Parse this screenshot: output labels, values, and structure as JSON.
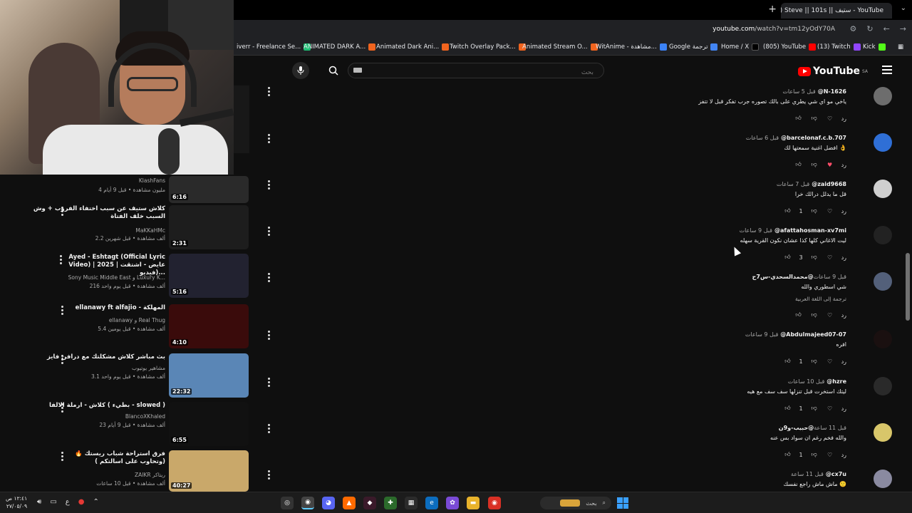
{
  "browser": {
    "tab_title": "(77) Steve || 101s || ستيف - YouTube",
    "url": "youtube.com/watch?v=tm12yOdY70A",
    "url_host": "youtube.com",
    "url_path": "/watch?v=tm12yOdY70A",
    "bookmarks": [
      {
        "label": "iverr - Freelance Se...",
        "icon_color": "#1dbf73"
      },
      {
        "label": "ANIMATED DARK A...",
        "icon_color": "#f1641e"
      },
      {
        "label": "Animated Dark Ani...",
        "icon_color": "#f1641e"
      },
      {
        "label": "Twitch Overlay Pack...",
        "icon_color": "#f1641e"
      },
      {
        "label": "Animated Stream O...",
        "icon_color": "#f1641e"
      },
      {
        "label": "WitAnime - مشاهدة...",
        "icon_color": "#3b82f6"
      },
      {
        "label": "Google ترجمة",
        "icon_color": "#4285f4"
      },
      {
        "label": "Home / X",
        "icon_color": "#000000"
      },
      {
        "label": "(805) YouTube",
        "icon_color": "#ff0000"
      },
      {
        "label": "(13) Twitch",
        "icon_color": "#9146ff"
      },
      {
        "label": "Kick",
        "icon_color": "#53fc18"
      }
    ]
  },
  "header": {
    "logo": "YouTube",
    "region": "SA",
    "search_placeholder": "بحث"
  },
  "suggested": [
    {
      "title": "",
      "channel": "KlashFans",
      "meta": "4 مليون مشاهدة • قبل 9 أيام",
      "duration": "6:16",
      "thumb": "#2a2a2a"
    },
    {
      "title": "كلاش ستيف عن سبب اختفاء الفروب + وش السبب خلف الفتاة",
      "channel": "MaKKaHMc",
      "meta": "2.2 ألف مشاهدة • قبل شهرين",
      "duration": "2:31",
      "thumb": "#1d1d1d"
    },
    {
      "title": "Ayed - Eshtagt (Official Lyric Video) | 2025 | عايض - اشتقت (فيديو...",
      "channel": "Sony Music Middle East و Luxury K...",
      "meta": "216 ألف مشاهدة • قبل يوم واحد",
      "duration": "5:16",
      "thumb": "#222230"
    },
    {
      "title": "ellanawy ft alfajio - المهلكة",
      "channel": "ellanawy و Real Thug",
      "meta": "5.4 ألف مشاهدة • قبل يومين",
      "duration": "4:10",
      "thumb": "#3a0b0b"
    },
    {
      "title": "بث مباشر كلاش مشكلتك مع درافن فايز",
      "channel": "مشاهير يوتيوب",
      "meta": "3.1 ألف مشاهدة • قبل يوم واحد",
      "duration": "22:32",
      "thumb": "#5a86b6"
    },
    {
      "title": "كلاش - ارملة الالفا ( بطيء - slowed )",
      "channel": "BlancoXKhaled",
      "meta": "23 ألف مشاهدة • قبل 9 أيام",
      "duration": "6:55",
      "thumb": "#111111"
    },
    {
      "title": "فرق استراحة شباب ريستك 🔥 (وتحاوب على اسالتكم )",
      "channel": "ZAIKR ريتاكر",
      "meta": "ألف مشاهدة • قبل 10 ساعات",
      "duration": "40:27",
      "thumb": "#c9a86a"
    }
  ],
  "comments": [
    {
      "user": "@N-1626",
      "time": "قبل 5 ساعات",
      "text": "ياخي مو اي شي يطري على بالك تصوره جرب تفكر قبل لا تتفز",
      "likes": "",
      "reply": "رد",
      "avatar": "#6d6d6d"
    },
    {
      "user": "@barcelonaf.c.b.707",
      "time": "قبل 6 ساعات",
      "text": "افضل اغنية سمعتها لك 👌",
      "likes": "",
      "reply": "رد",
      "avatar": "#2f6fd6",
      "hearted": true
    },
    {
      "user": "@zaid9668",
      "time": "قبل 7 ساعات",
      "text": "قل ما يدلل درالك خرا",
      "likes": "1",
      "reply": "رد",
      "avatar": "#cfcfcf"
    },
    {
      "user": "@afattahosman-xv7mi",
      "time": "قبل 9 ساعات",
      "text": "ليت الاغاني كلها كذا عشان نكون القرية سهله",
      "likes": "3",
      "reply": "رد",
      "avatar": "#222222"
    },
    {
      "user": "@محمدالسحدي-س7ح",
      "time": "قبل 9 ساعات",
      "text": "شي اسطوري والله",
      "translate": "ترجمة إلى اللغة العربية",
      "likes": "",
      "reply": "رد",
      "avatar": "#53607a"
    },
    {
      "user": "@Abdulmajeed07-07",
      "time": "قبل 9 ساعات",
      "text": "افره",
      "likes": "1",
      "reply": "رد",
      "avatar": "#1a1010"
    },
    {
      "user": "@hzre",
      "time": "قبل 10 ساعات",
      "text": "ليتك استخرت قبل تنزلها سف سف مع هيه",
      "likes": "1",
      "reply": "رد",
      "avatar": "#2a2a2a"
    },
    {
      "user": "@حبيب-و9ن",
      "time": "قبل 11 ساعة",
      "text": "والله فخم رغم ان سواد بس عنه",
      "likes": "1",
      "reply": "رد",
      "avatar": "#d8c66a"
    },
    {
      "user": "@cx7u",
      "time": "قبل 11 ساعة",
      "text": "ماش ماش راجع نفسك 🙂",
      "likes": "",
      "reply": "رد",
      "avatar": "#8a8aa0"
    }
  ],
  "taskbar": {
    "search_label": "بحث",
    "clock_time": "١٢:٤١ ص",
    "clock_date": "٢٧/٠٥/٠٩",
    "lang": "ع"
  }
}
